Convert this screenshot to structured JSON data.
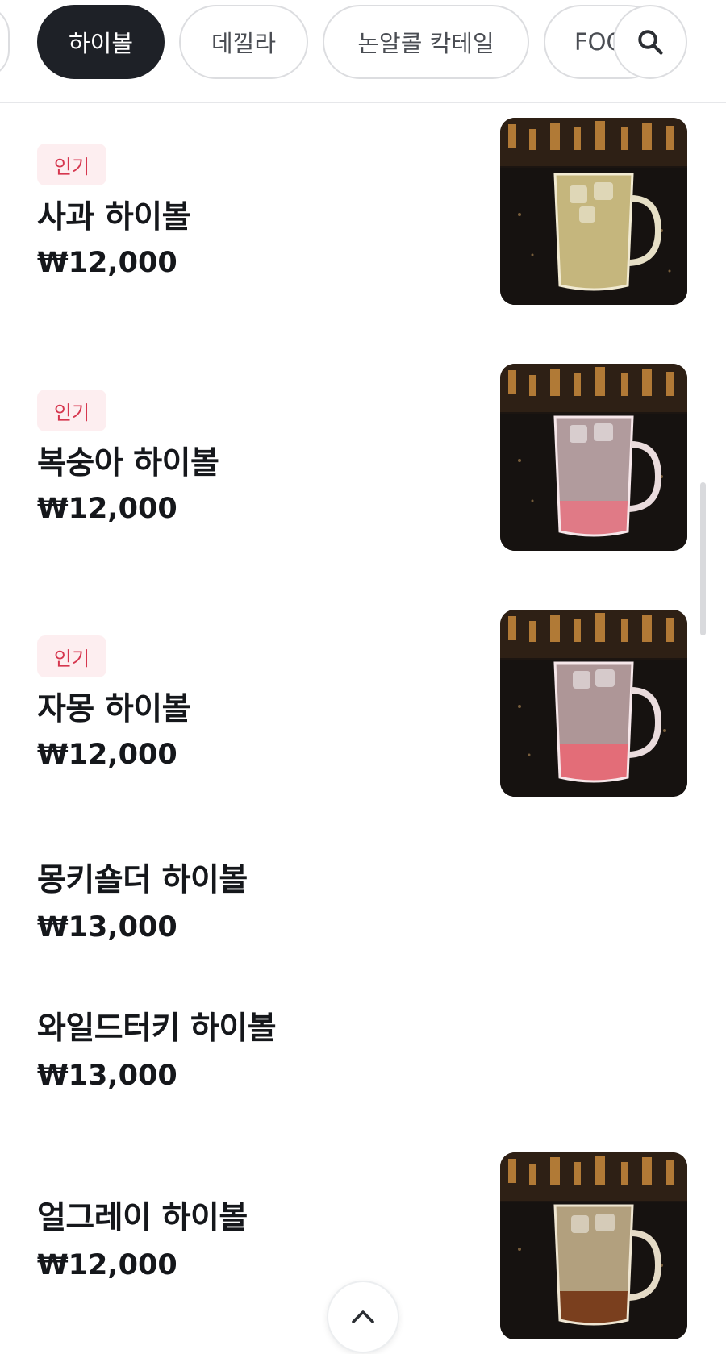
{
  "tabs": {
    "partial_left": "",
    "items": [
      {
        "label": "하이볼",
        "active": true
      },
      {
        "label": "데낄라",
        "active": false
      },
      {
        "label": "논알콜 칵테일",
        "active": false
      },
      {
        "label": "FOOD",
        "active": false
      }
    ],
    "search_icon": "search-icon"
  },
  "menu": {
    "items": [
      {
        "badge": "인기",
        "name": "사과 하이볼",
        "price": "₩12,000",
        "has_image": true,
        "drink_color": "#d8c98a"
      },
      {
        "badge": "인기",
        "name": "복숭아 하이볼",
        "price": "₩12,000",
        "has_image": true,
        "drink_color": "#e07a86"
      },
      {
        "badge": "인기",
        "name": "자몽 하이볼",
        "price": "₩12,000",
        "has_image": true,
        "drink_color": "#e36d78"
      },
      {
        "badge": "",
        "name": "몽키숄더 하이볼",
        "price": "₩13,000",
        "has_image": false
      },
      {
        "badge": "",
        "name": "와일드터키 하이볼",
        "price": "₩13,000",
        "has_image": false
      },
      {
        "badge": "",
        "name": "얼그레이 하이볼",
        "price": "₩12,000",
        "has_image": true,
        "drink_color": "#b48a4a"
      }
    ]
  },
  "colors": {
    "active_tab_bg": "#1e2127",
    "badge_bg": "#fdeef0",
    "badge_text": "#d6374f"
  },
  "back_to_top_icon": "chevron-up-icon"
}
